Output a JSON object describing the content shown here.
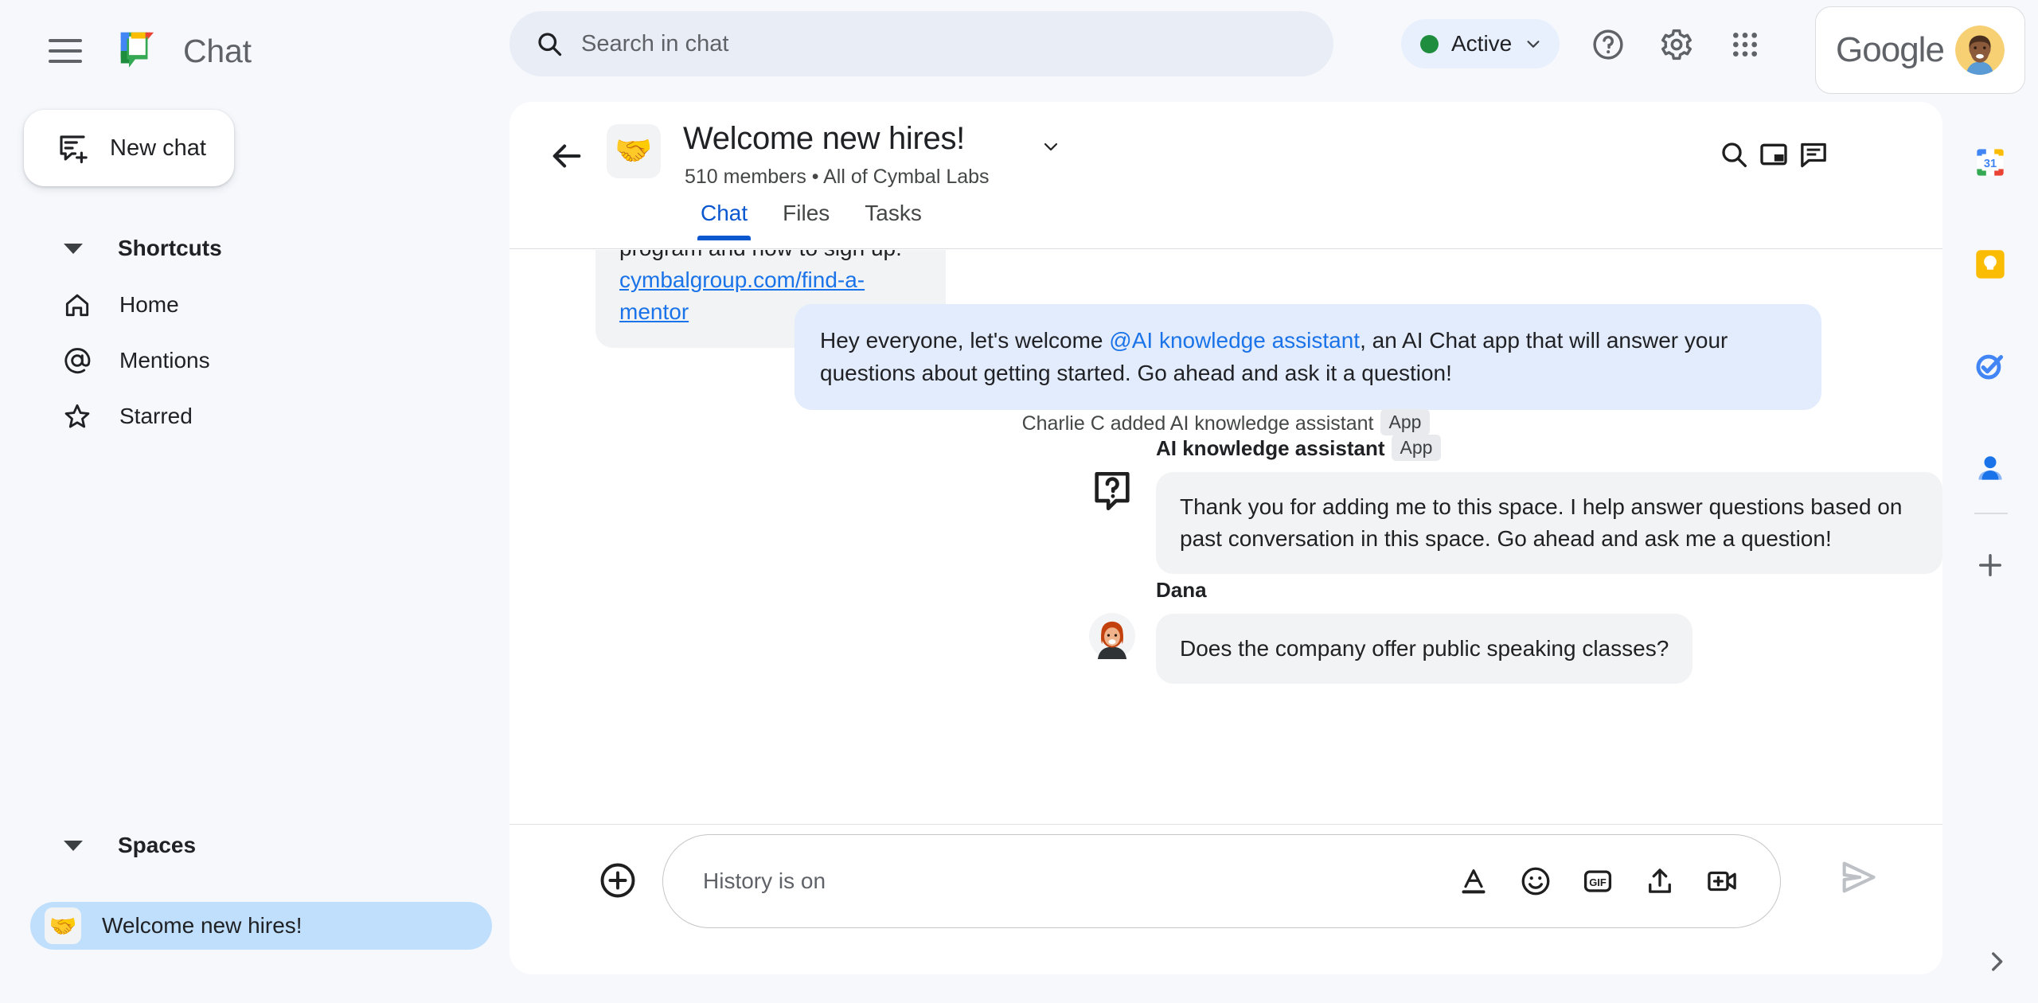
{
  "app": {
    "name": "Chat",
    "logo_icon": "google-chat-logo"
  },
  "topbar": {
    "menu_icon": "hamburger-menu-icon",
    "search": {
      "placeholder": "Search in chat",
      "icon": "search-icon"
    },
    "status": {
      "label": "Active",
      "dot_color": "#1e8e3e",
      "caret_icon": "chevron-down-icon"
    },
    "help_icon": "help-circle-icon",
    "settings_icon": "gear-icon",
    "apps_icon": "apps-grid-icon",
    "account": {
      "brand": "Google",
      "avatar_icon": "user-avatar"
    }
  },
  "sidebar": {
    "new_chat": {
      "label": "New chat",
      "icon": "new-chat-icon"
    },
    "shortcuts": {
      "title": "Shortcuts",
      "caret_icon": "caret-down-icon",
      "items": [
        {
          "label": "Home",
          "icon": "home-icon"
        },
        {
          "label": "Mentions",
          "icon": "at-mention-icon"
        },
        {
          "label": "Starred",
          "icon": "star-icon"
        }
      ]
    },
    "spaces": {
      "title": "Spaces",
      "caret_icon": "caret-down-icon",
      "items": [
        {
          "label": "Welcome new hires!",
          "emoji": "🤝",
          "selected": true
        }
      ]
    }
  },
  "space": {
    "back_icon": "back-arrow-icon",
    "emoji": "🤝",
    "title": "Welcome new hires!",
    "title_caret_icon": "chevron-down-icon",
    "members": "510 members",
    "separator": "•",
    "org": "All of Cymbal Labs",
    "subtitle": "510 members  •  All of Cymbal Labs",
    "header_icons": [
      {
        "name": "search-icon"
      },
      {
        "name": "picture-in-picture-icon"
      },
      {
        "name": "open-chat-panel-icon"
      }
    ],
    "tabs": [
      {
        "label": "Chat",
        "active": true
      },
      {
        "label": "Files",
        "active": false
      },
      {
        "label": "Tasks",
        "active": false
      }
    ]
  },
  "thread": {
    "partial_message": {
      "line1": "program and how to sign up:",
      "link": "cymbalgroup.com/find-a-mentor"
    },
    "outgoing_message": {
      "text_before": "Hey everyone, let's welcome ",
      "mention": "@AI knowledge assistant",
      "text_after": ", an AI Chat app that will answer your questions about getting started.  Go ahead and ask it a question!"
    },
    "system_message": {
      "text": "Charlie C added AI knowledge assistant",
      "badge": "App"
    },
    "messages": [
      {
        "sender": "AI knowledge assistant",
        "badge": "App",
        "avatar_icon": "question-bubble-avatar",
        "text": "Thank you for adding me to this space. I help answer questions based on past conversation in this space. Go ahead and ask me a question!"
      },
      {
        "sender": "Dana",
        "badge": "",
        "avatar_icon": "dana-avatar",
        "text": "Does the company offer public speaking classes?"
      }
    ]
  },
  "composer": {
    "add_icon": "plus-circle-icon",
    "placeholder": "History is on",
    "icons": [
      {
        "name": "text-format-icon"
      },
      {
        "name": "emoji-icon"
      },
      {
        "name": "gif-icon"
      },
      {
        "name": "upload-file-icon"
      },
      {
        "name": "add-video-meeting-icon"
      }
    ],
    "send_icon": "send-icon"
  },
  "rail": {
    "items": [
      {
        "name": "google-calendar-icon",
        "label": "31"
      },
      {
        "name": "google-keep-icon",
        "label": ""
      },
      {
        "name": "google-tasks-icon",
        "label": ""
      },
      {
        "name": "google-contacts-icon",
        "label": ""
      }
    ],
    "add_icon": "plus-icon",
    "expand_icon": "chevron-right-icon"
  },
  "colors": {
    "page_bg": "#f6f8fc",
    "panel_bg": "#ffffff",
    "accent_blue": "#0b57d0",
    "link_blue": "#1a73e8",
    "bubble_in": "#f1f3f4",
    "bubble_out": "#e3ecfd",
    "space_selected": "#bfdffc",
    "status_green": "#1e8e3e"
  }
}
